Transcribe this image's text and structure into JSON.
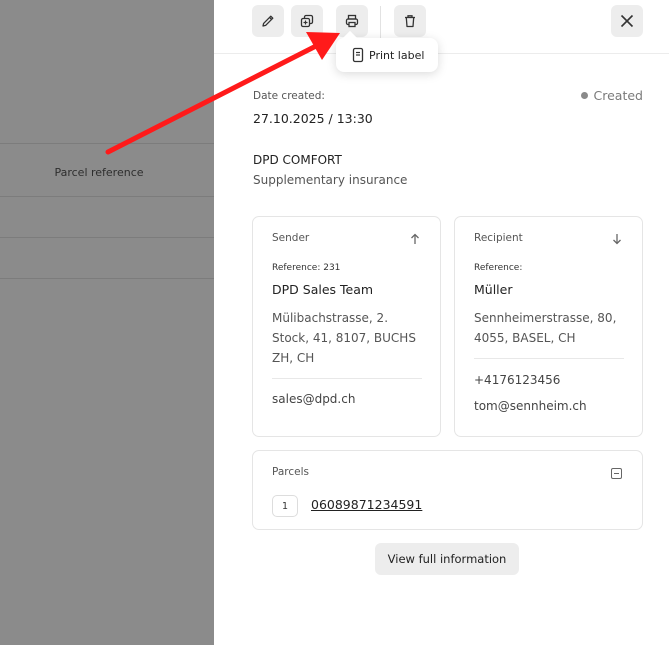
{
  "background": {
    "column_label": "Parcel reference"
  },
  "toolbar": {
    "buttons": [
      {
        "icon": "pencil-icon",
        "name": "edit-button"
      },
      {
        "icon": "duplicate-icon",
        "name": "duplicate-button"
      },
      {
        "icon": "printer-icon",
        "name": "print-button"
      },
      {
        "icon": "trash-icon",
        "name": "delete-button"
      }
    ],
    "close_icon": "close-icon",
    "tooltip": "Print label"
  },
  "details": {
    "date_label": "Date created:",
    "date_value": "27.10.2025 / 13:30",
    "status": "Created",
    "status_color": "#8a8a8a",
    "service": "DPD COMFORT",
    "insurance": "Supplementary insurance"
  },
  "sender": {
    "heading": "Sender",
    "reference": "Reference: 231",
    "name": "DPD Sales Team",
    "address": "Mülibachstrasse, 2. Stock, 41, 8107, BUCHS ZH, CH",
    "email": "sales@dpd.ch"
  },
  "recipient": {
    "heading": "Recipient",
    "reference": "Reference:",
    "name": "Müller",
    "address": "Sennheimerstrasse, 80, 4055, BASEL, CH",
    "phone": "+4176123456",
    "email": "tom@sennheim.ch"
  },
  "parcels": {
    "heading": "Parcels",
    "items": [
      {
        "index": "1",
        "number": "06089871234591"
      }
    ]
  },
  "actions": {
    "full_info": "View full information"
  },
  "colors": {
    "overlay": "#8b8b8b",
    "annotation_arrow": "#ff1a1a"
  }
}
